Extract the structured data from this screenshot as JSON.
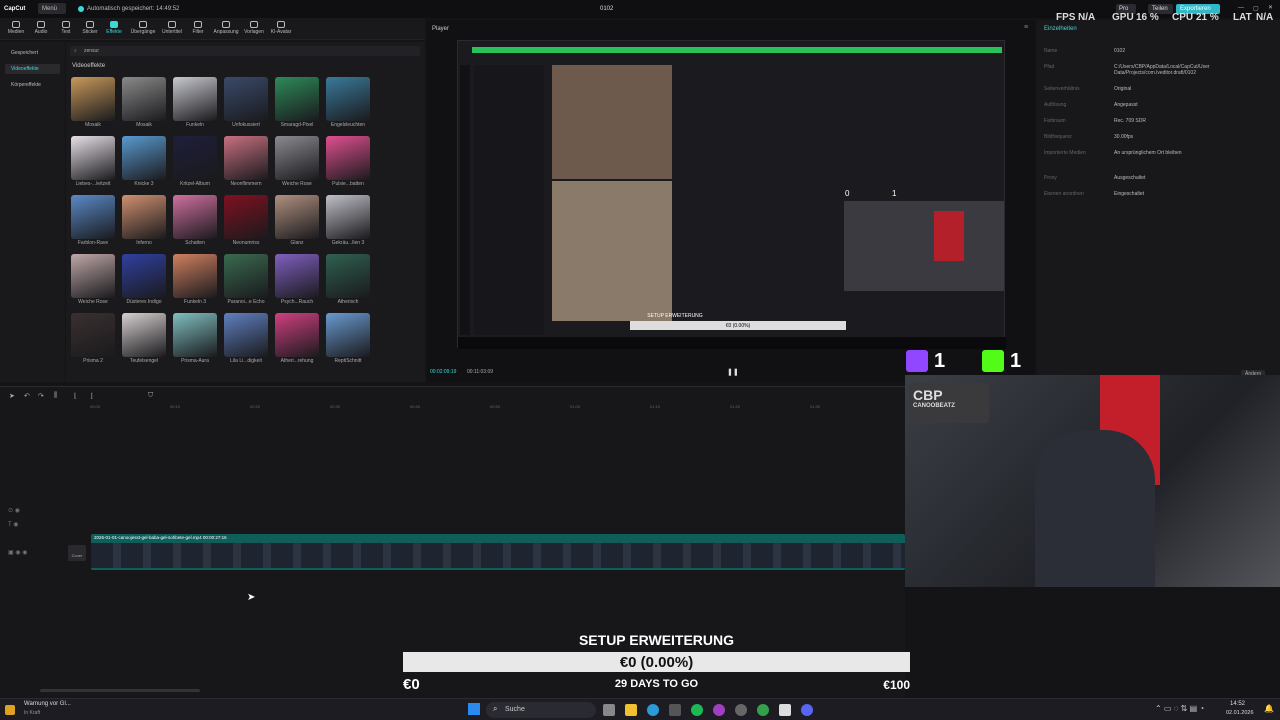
{
  "app": {
    "logo": "CapCut",
    "menu_label": "Menü",
    "autosave": "Automatisch gespeichert: 14:49:52",
    "project_title": "0102",
    "pro_label": "Pro",
    "share_label": "Teilen",
    "export_label": "Exportieren"
  },
  "toolbar": {
    "items": [
      "Medien",
      "Audio",
      "Text",
      "Sticker",
      "Effekte",
      "Übergänge",
      "Untertitel",
      "Filter",
      "Anpassung",
      "Vorlagen",
      "KI-Avatar"
    ]
  },
  "sidenav": {
    "items": [
      "Gespeichert",
      "Videoeffekte",
      "Körpereffekte"
    ]
  },
  "effects": {
    "search_placeholder": "zensur",
    "section_title": "Videoeffekte",
    "cards": [
      {
        "label": "Mosaik",
        "color": "#c9995a"
      },
      {
        "label": "Mosaik",
        "color": "#8a8a8a"
      },
      {
        "label": "Funkeln",
        "color": "#c8c8d0"
      },
      {
        "label": "Unfokussiert",
        "color": "#3a4a6a"
      },
      {
        "label": "Smaragd-Pixel",
        "color": "#2e8a5a"
      },
      {
        "label": "Engelsleuchten",
        "color": "#3a7a9a"
      },
      {
        "label": "Liebes-...leitzeit",
        "color": "#e8e0e8"
      },
      {
        "label": "Knicke 3",
        "color": "#5a9ad0"
      },
      {
        "label": "Kritzel-Album",
        "color": "#1e1e3a"
      },
      {
        "label": "Neonflimmern",
        "color": "#c87080"
      },
      {
        "label": "Weiche Rose",
        "color": "#8a8a90"
      },
      {
        "label": "Pulsie...batten",
        "color": "#e05090"
      },
      {
        "label": "Farblon-Rave",
        "color": "#5a8ac8"
      },
      {
        "label": "Inferno",
        "color": "#d09070"
      },
      {
        "label": "Schatten",
        "color": "#d070a0"
      },
      {
        "label": "Neonumriss",
        "color": "#801020"
      },
      {
        "label": "Glanz",
        "color": "#b09080"
      },
      {
        "label": "Gekräu...llen 3",
        "color": "#c0c0c8"
      },
      {
        "label": "Weiche Rose",
        "color": "#c0a8a8"
      },
      {
        "label": "Düsteres Indigo",
        "color": "#3040a0"
      },
      {
        "label": "Funkeln 3",
        "color": "#d08060"
      },
      {
        "label": "Paranoi...e Echo",
        "color": "#3a6a50"
      },
      {
        "label": "Psych...Rauch",
        "color": "#8060c0"
      },
      {
        "label": "Ätherisch",
        "color": "#306050"
      },
      {
        "label": "Prisma 2",
        "color": "#3a3030"
      },
      {
        "label": "Teufelsengel",
        "color": "#d8d0d0"
      },
      {
        "label": "Prisma-Aura",
        "color": "#80c0c0"
      },
      {
        "label": "Lila Li...digkeit",
        "color": "#6080c0"
      },
      {
        "label": "Atheri...rehung",
        "color": "#d04080"
      },
      {
        "label": "ReptiSchnitt",
        "color": "#6a9ad0"
      }
    ]
  },
  "player": {
    "label": "Player",
    "time_current": "00:02:09:19",
    "time_total": "00:11:03:09"
  },
  "props": {
    "tab": "Einzelheiten",
    "rows": [
      {
        "k": "Name",
        "v": "0102"
      },
      {
        "k": "Pfad",
        "v": "C:/Users/CBP/AppData/Local/CapCut/User Data/Projects/com.lveditor.draft/0102"
      },
      {
        "k": "Seitenverhältnis",
        "v": "Original"
      },
      {
        "k": "Auflösung",
        "v": "Angepasst"
      },
      {
        "k": "Farbraum",
        "v": "Rec. 709 SDR"
      },
      {
        "k": "Bildfrequenz",
        "v": "30.00fps"
      },
      {
        "k": "Importierte Medien",
        "v": "An ursprünglichem Ort bleiben"
      },
      {
        "k": "Proxy",
        "v": "Ausgeschaltet"
      },
      {
        "k": "Ebenen anordnen",
        "v": "Eingeschaltet"
      }
    ],
    "edit_button": "Ändern"
  },
  "stats": {
    "fps_label": "FPS",
    "fps_value": "N/A",
    "gpu_label": "GPU",
    "gpu_value": "16 %",
    "cpu_label": "CPU",
    "cpu_value": "21 %",
    "lat_label": "LAT",
    "lat_value": "N/A"
  },
  "timeline": {
    "ruler": [
      "00:00",
      "00:10",
      "00:20",
      "00:30",
      "00:40",
      "00:50",
      "01:00",
      "01:10",
      "01:20",
      "01:30"
    ],
    "clip_label": "2026-01-01-canoojesst-gel-baba-gel-sohbete-gel.mp4  00:00:27:16",
    "cover_label": "Cover"
  },
  "cam": {
    "platform1_count": "1",
    "platform2_count": "1",
    "brand": "CBP",
    "brand_sub": "CANOOBEATZ"
  },
  "inner_counts": {
    "a": "0",
    "b": "1"
  },
  "overlay": {
    "title": "SETUP ERWEITERUNG",
    "progress_text": "€0 (0.00%)",
    "progress_value": 0.0,
    "left": "€0",
    "center": "29 DAYS TO GO",
    "right": "€100"
  },
  "taskbar": {
    "notice_title": "Warnung vor Gl...",
    "notice_sub": "In Kraft",
    "search_placeholder": "Suche",
    "time": "14:52",
    "date": "02.01.2026"
  }
}
